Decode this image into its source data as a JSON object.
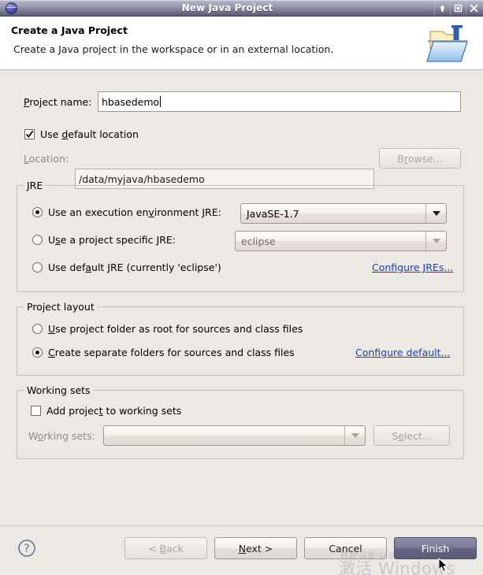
{
  "window": {
    "title": "New Java Project",
    "app_icon": "eclipse-globe-icon",
    "controls": {
      "shade_label": "shade-window",
      "maximize_label": "maximize-window",
      "close_label": "close-window"
    }
  },
  "header": {
    "title": "Create a Java Project",
    "description": "Create a Java project in the workspace or in an external location.",
    "icon": "java-project-folder-icon"
  },
  "project_name": {
    "label_pre": "P",
    "label_post": "roject name:",
    "value": "hbasedemo"
  },
  "location": {
    "use_default_checkbox": {
      "label_pre": "Use ",
      "label_mn": "d",
      "label_post": "efault location",
      "checked": true
    },
    "label_mn": "L",
    "label_post": "ocation:",
    "value": "/data/myjava/hbasedemo",
    "browse_label_pre": "B",
    "browse_label_mn": "r",
    "browse_label_post": "owse...",
    "browse_enabled": false
  },
  "jre": {
    "group_title": "JRE",
    "option_env": {
      "label_pre": "Use an execution en",
      "label_mn": "v",
      "label_post": "ironment JRE:",
      "selected": true,
      "combo_value": "JavaSE-1.7",
      "combo_enabled": true
    },
    "option_specific": {
      "label_pre": "U",
      "label_mn": "s",
      "label_post": "e a project specific JRE:",
      "selected": false,
      "combo_value": "eclipse",
      "combo_enabled": false
    },
    "option_default": {
      "label_pre": "Use def",
      "label_mn": "a",
      "label_post": "ult JRE (currently 'eclipse')",
      "selected": false
    },
    "configure_link": "Configure JREs..."
  },
  "project_layout": {
    "group_title": "Project layout",
    "option_root": {
      "label_mn": "U",
      "label_post": "se project folder as root for sources and class files",
      "selected": false
    },
    "option_separate": {
      "label_mn": "C",
      "label_post": "reate separate folders for sources and class files",
      "selected": true
    },
    "configure_link": "Configure default..."
  },
  "working_sets": {
    "group_title": "Working sets",
    "add_checkbox": {
      "label_pre": "Add projec",
      "label_mn": "t",
      "label_post": " to working sets",
      "checked": false
    },
    "label_pre": "W",
    "label_mn": "o",
    "label_post": "rking sets:",
    "combo_value": "",
    "combo_enabled": false,
    "select_label_pre": "S",
    "select_label_mn": "e",
    "select_label_post": "lect...",
    "select_enabled": false
  },
  "footer": {
    "help_icon": "help-question-icon",
    "buttons": [
      {
        "id": "back",
        "label_pre": "< ",
        "label_mn": "B",
        "label_post": "ack",
        "enabled": false,
        "default": false
      },
      {
        "id": "next",
        "label_pre": "",
        "label_mn": "N",
        "label_post": "ext >",
        "enabled": true,
        "default": false
      },
      {
        "id": "cancel",
        "label_pre": "",
        "label_mn": "",
        "label_post": "Cancel",
        "enabled": true,
        "default": false
      },
      {
        "id": "finish",
        "label_pre": "",
        "label_mn": "",
        "label_post": "Finish",
        "enabled": true,
        "default": true
      }
    ]
  },
  "watermark": {
    "line1": "激活 Windows",
    "line2": "转到\"设置\"以激活 Windows。"
  },
  "colors": {
    "dialog_bg": "#ece9e4",
    "titlebar_top": "#b9bacb",
    "titlebar_bottom": "#5b5c73",
    "link": "#1a3fc4",
    "default_button": "#63647f"
  }
}
